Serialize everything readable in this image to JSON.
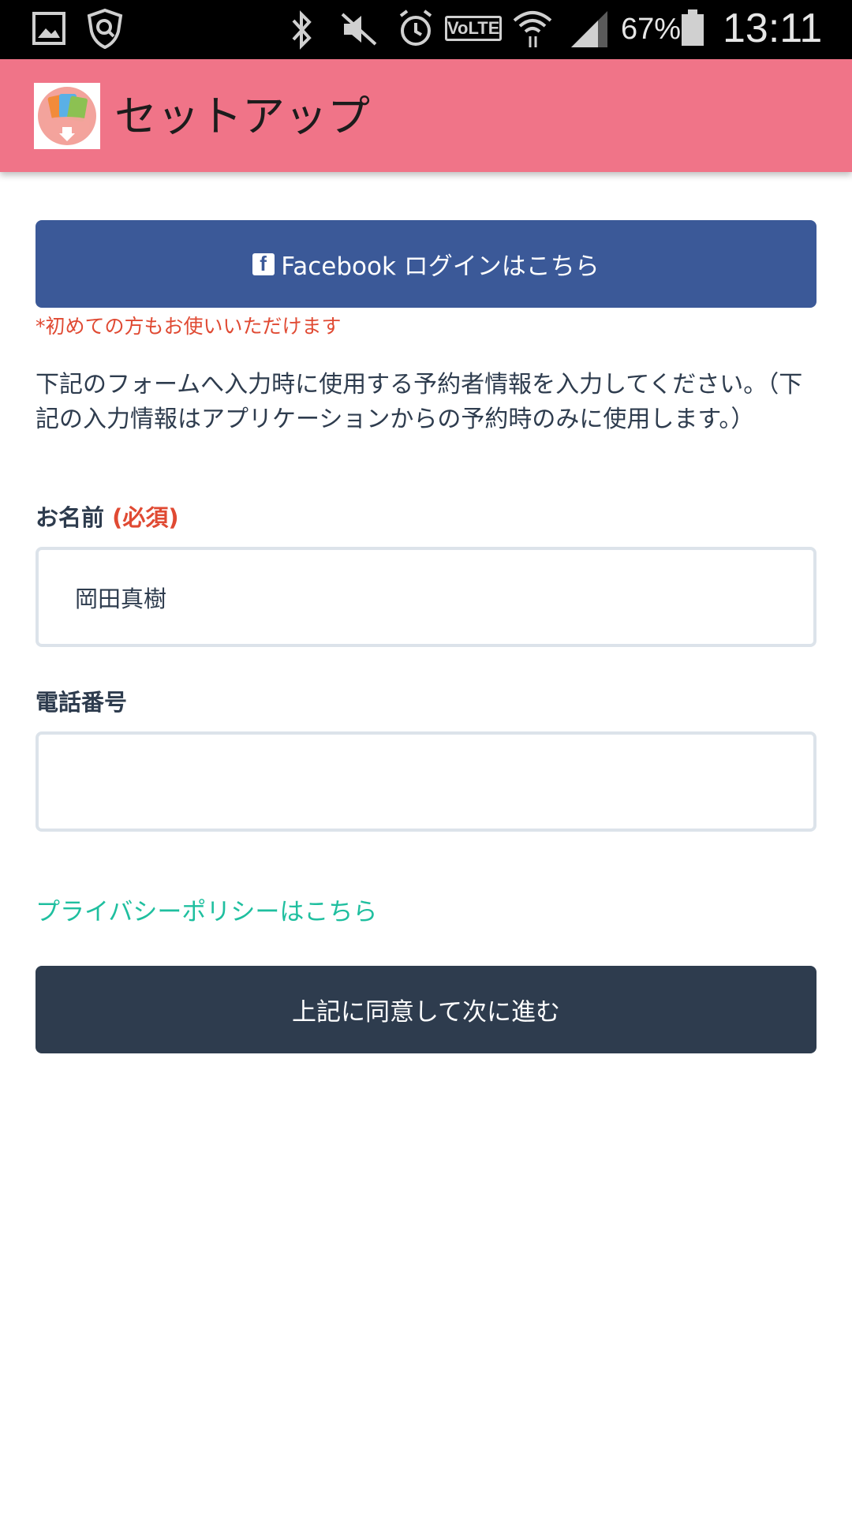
{
  "status_bar": {
    "battery_percent": "67%",
    "time": "13:11",
    "icons": [
      "gallery-icon",
      "shield-icon",
      "bluetooth-icon",
      "mute-icon",
      "alarm-icon",
      "volte-icon",
      "wifi-icon",
      "signal-icon",
      "battery-icon"
    ],
    "volte_label": "VoLTE"
  },
  "app_bar": {
    "title": "セットアップ",
    "background": "#f07488"
  },
  "facebook": {
    "button_label": "Facebook ログインはこちら",
    "note": "*初めての方もお使いいただけます",
    "color": "#3b5998"
  },
  "description": "下記のフォームへ入力時に使用する予約者情報を入力してください。（下記の入力情報はアプリケーションからの予約時のみに使用します。）",
  "form": {
    "name_label": "お名前",
    "required_label": "(必須)",
    "name_value": "岡田真樹",
    "phone_label": "電話番号",
    "phone_value": ""
  },
  "privacy_link": "プライバシーポリシーはこちら",
  "next_button": "上記に同意して次に進む",
  "colors": {
    "accent_red": "#e04a33",
    "link_green": "#1fbf9f",
    "dark_button": "#2e3c4e"
  }
}
